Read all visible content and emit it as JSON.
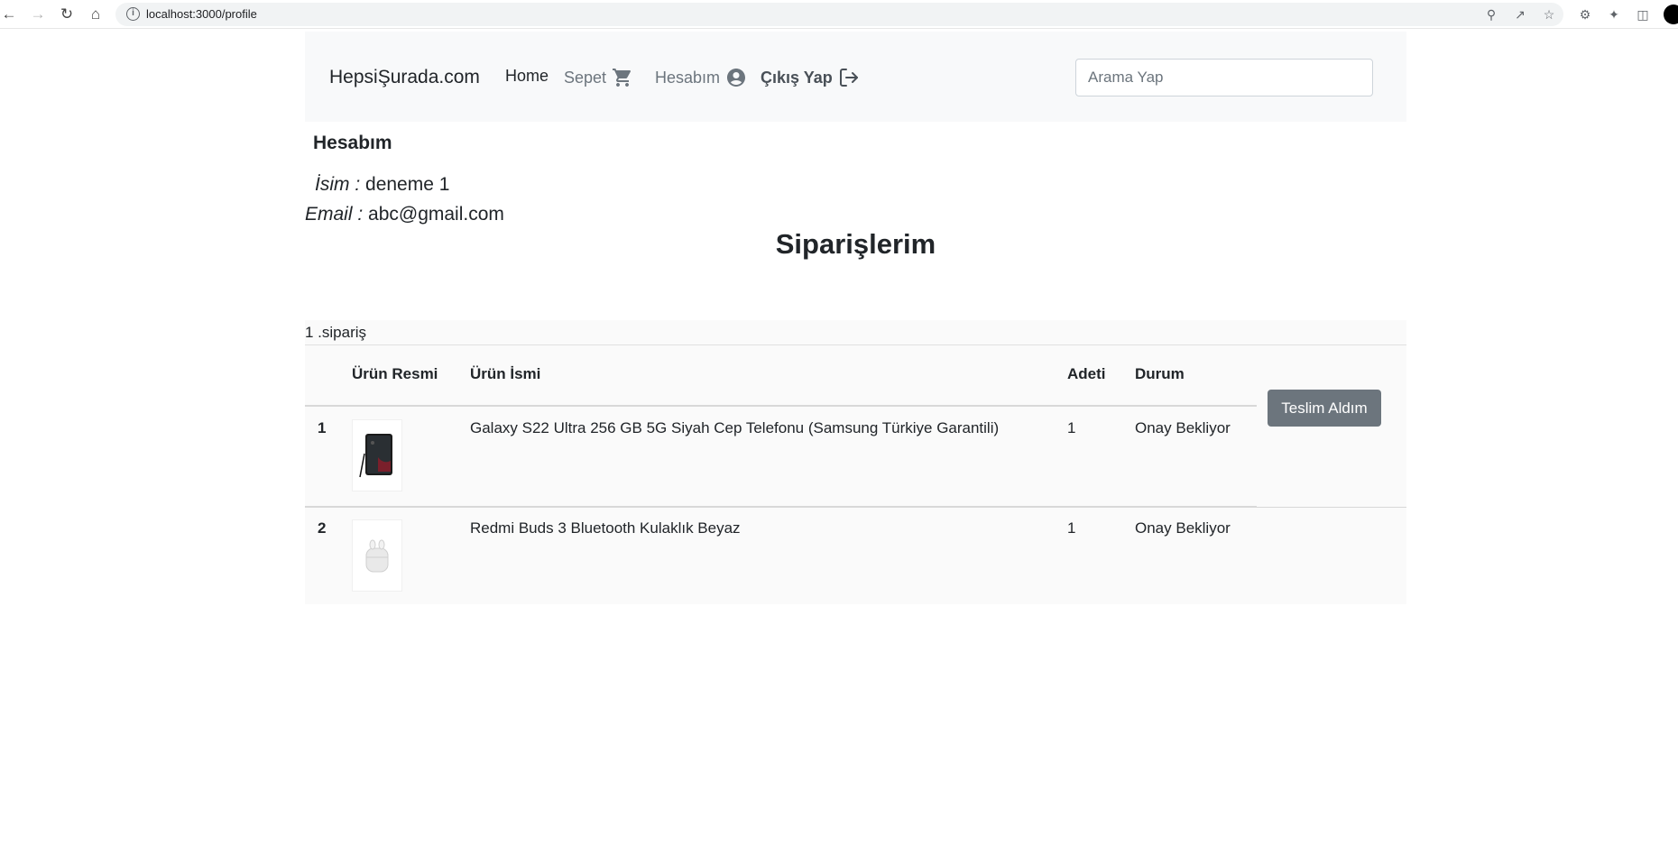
{
  "browser": {
    "url": "localhost:3000/profile"
  },
  "navbar": {
    "brand": "HepsiŞurada.com",
    "home": "Home",
    "cart": "Sepet",
    "account": "Hesabım",
    "logout": "Çıkış Yap",
    "search_placeholder": "Arama Yap"
  },
  "account": {
    "title": "Hesabım",
    "name_label": "İsim :",
    "name_value": "deneme 1",
    "email_label": "Email :",
    "email_value": "abc@gmail.com"
  },
  "orders": {
    "title": "Siparişlerim",
    "order_label": "1 .sipariş",
    "columns": [
      "",
      "Ürün Resmi",
      "Ürün İsmi",
      "Adeti",
      "Durum"
    ],
    "deliver_button": "Teslim Aldım",
    "items": [
      {
        "no": "1",
        "name": "Galaxy S22 Ultra 256 GB 5G Siyah Cep Telefonu (Samsung Türkiye Garantili)",
        "qty": "1",
        "status": "Onay Bekliyor",
        "image": "phone-image"
      },
      {
        "no": "2",
        "name": "Redmi Buds 3 Bluetooth Kulaklık Beyaz",
        "qty": "1",
        "status": "Onay Bekliyor",
        "image": "earbuds-image"
      }
    ]
  },
  "colors": {
    "navbar_bg": "#f8f9fa",
    "button_secondary": "#6c757d",
    "muted_text": "#6c757d"
  }
}
